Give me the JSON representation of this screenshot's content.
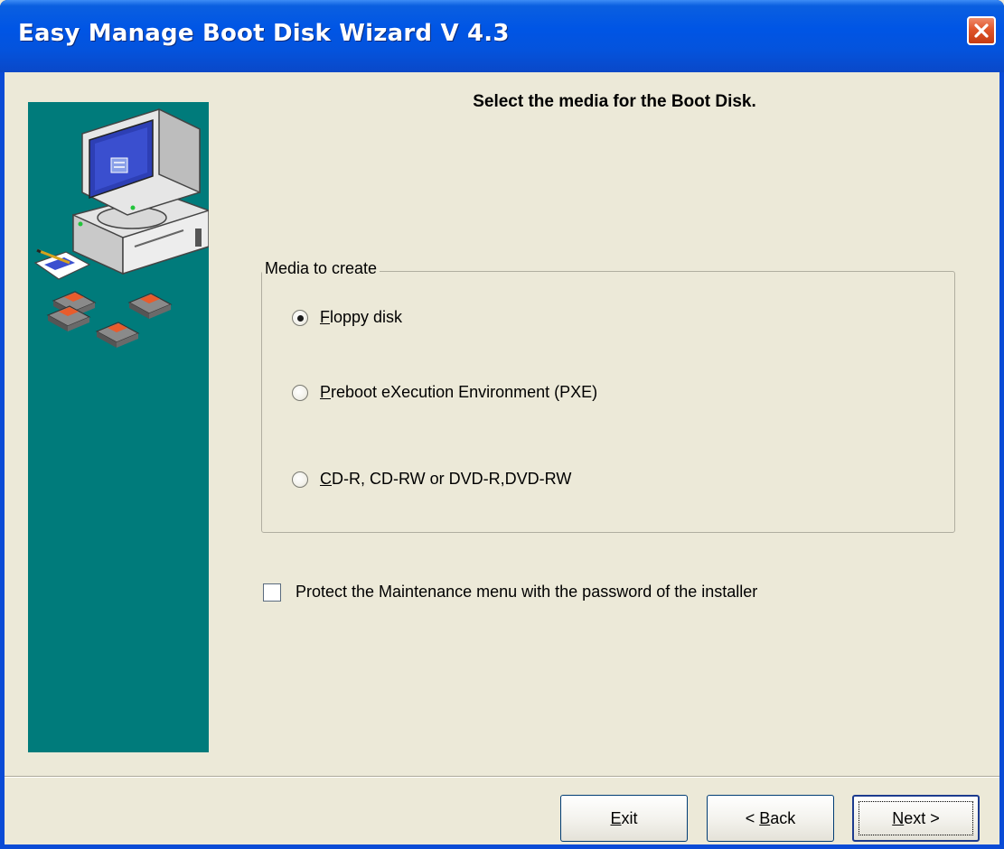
{
  "window": {
    "title": "Easy Manage Boot Disk Wizard V 4.3"
  },
  "page": {
    "heading": "Select the media for the Boot Disk."
  },
  "media_group": {
    "legend": "Media to create",
    "options": [
      {
        "mnemonic": "F",
        "rest": "loppy disk",
        "checked": true
      },
      {
        "mnemonic": "P",
        "rest": "reboot eXecution Environment (PXE)",
        "checked": false
      },
      {
        "mnemonic": "C",
        "rest": "D-R, CD-RW or DVD-R,DVD-RW",
        "checked": false
      }
    ]
  },
  "protect_option": {
    "label": "Protect the Maintenance menu with the password of the installer",
    "checked": false
  },
  "buttons": {
    "exit": {
      "mnemonic": "E",
      "rest": "xit"
    },
    "back": {
      "prefix": "< ",
      "mnemonic": "B",
      "rest": "ack"
    },
    "next": {
      "mnemonic": "N",
      "rest": "ext >"
    }
  },
  "colors": {
    "side_panel": "#007b7b",
    "title_bar": "#0055e5",
    "dialog_bg": "#ece9d8"
  }
}
